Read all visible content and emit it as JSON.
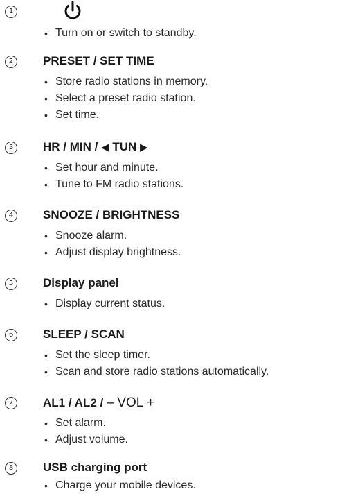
{
  "sections": [
    {
      "number": "1",
      "icon": "power-icon",
      "items": [
        "Turn on or switch to standby."
      ]
    },
    {
      "number": "2",
      "heading": "PRESET / SET TIME",
      "items": [
        "Store radio stations in memory.",
        "Select a preset radio station.",
        "Set time."
      ]
    },
    {
      "number": "3",
      "heading_parts": {
        "prefix": "HR / MIN /",
        "left_arrow": "◀",
        "middle": "TUN",
        "right_arrow": "▶"
      },
      "items": [
        "Set hour and minute.",
        "Tune to FM radio stations."
      ]
    },
    {
      "number": "4",
      "heading": "SNOOZE / BRIGHTNESS",
      "items": [
        "Snooze alarm.",
        "Adjust display brightness."
      ]
    },
    {
      "number": "5",
      "heading": "Display panel",
      "items": [
        "Display current status."
      ]
    },
    {
      "number": "6",
      "heading": "SLEEP / SCAN",
      "items": [
        "Set the sleep timer.",
        "Scan and store radio stations automatically."
      ]
    },
    {
      "number": "7",
      "heading_parts": {
        "prefix": "AL1 / AL2 /",
        "minus": "–",
        "vol": "VOL",
        "plus": "+"
      },
      "items": [
        "Set alarm.",
        "Adjust volume."
      ]
    },
    {
      "number": "8",
      "heading": "USB charging port",
      "items": [
        "Charge your mobile devices."
      ]
    }
  ]
}
